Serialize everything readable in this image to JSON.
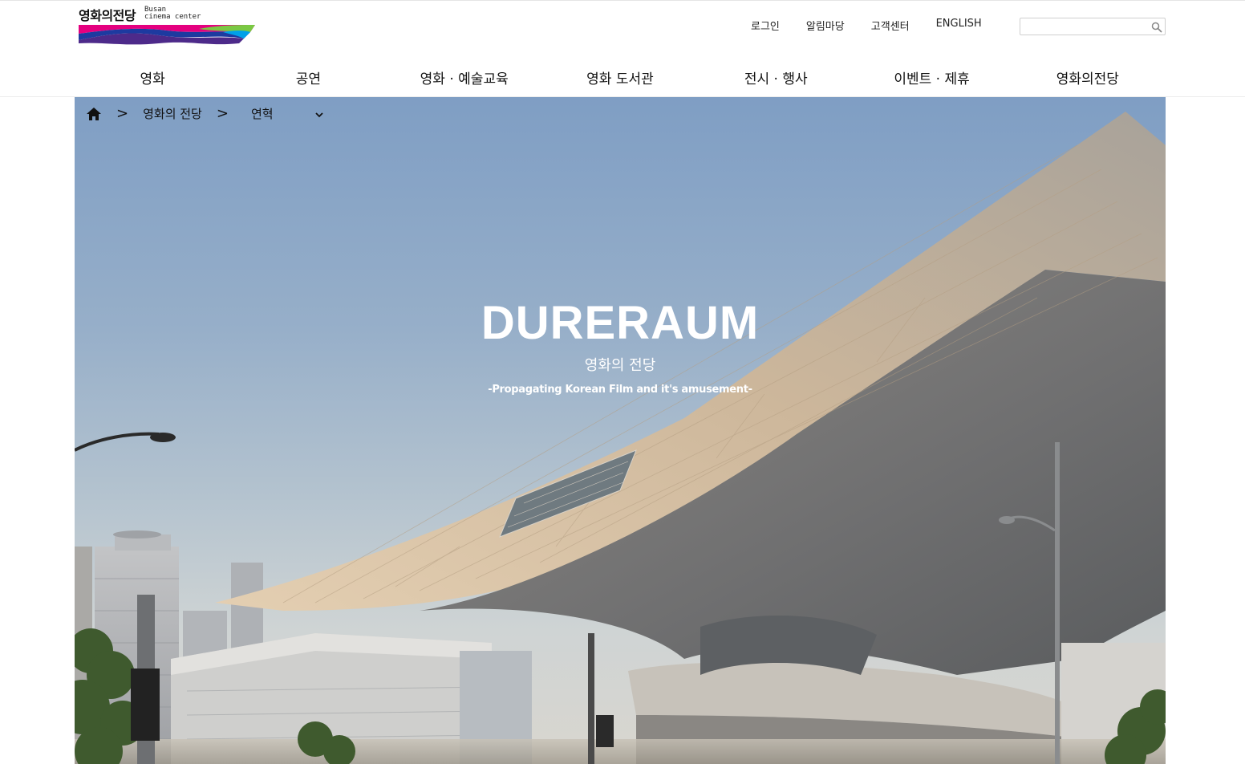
{
  "logo": {
    "name_ko": "영화의전당",
    "name_en_line1": "Busan",
    "name_en_line2": "cinema center",
    "colors": [
      "#e4007f",
      "#1d3aa0",
      "#7ac943",
      "#00a0e9"
    ]
  },
  "util_nav": [
    {
      "label": "로그인"
    },
    {
      "label": "알림마당"
    },
    {
      "label": "고객센터"
    },
    {
      "label": "ENGLISH"
    }
  ],
  "search": {
    "placeholder": "",
    "icon": "search-icon"
  },
  "main_nav": [
    {
      "label": "영화"
    },
    {
      "label": "공연"
    },
    {
      "label": "영화 · 예술교육"
    },
    {
      "label": "영화 도서관"
    },
    {
      "label": "전시 · 행사"
    },
    {
      "label": "이벤트 · 제휴"
    },
    {
      "label": "영화의전당"
    }
  ],
  "breadcrumb": {
    "home_icon": "home-icon",
    "separator": ">",
    "section": "영화의 전당",
    "current": "연혁",
    "dropdown_icon": "chevron-down-icon"
  },
  "hero": {
    "title": "DURERAUM",
    "subtitle": "영화의 전당",
    "tagline": "-Propagating Korean Film and it's amusement-"
  }
}
